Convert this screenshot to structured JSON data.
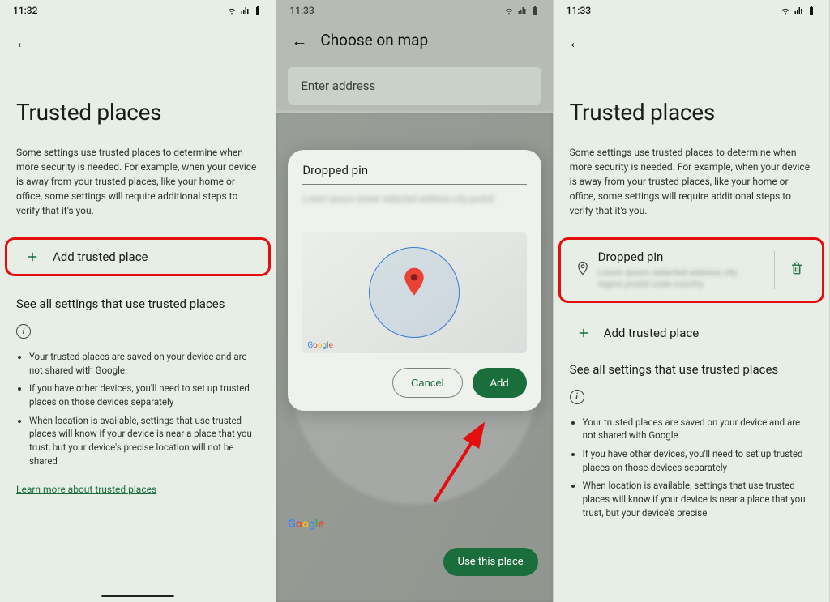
{
  "screen1": {
    "time": "11:32",
    "page_title": "Trusted places",
    "description": "Some settings use trusted places to determine when more security is needed. For example, when your device is away from your trusted places, like your home or office, some settings will require additional steps to verify that it's you.",
    "add_trusted_label": "Add trusted place",
    "section_title": "See all settings that use trusted places",
    "bullets": [
      "Your trusted places are saved on your device and are not shared with Google",
      "If you have other devices, you'll need to set up trusted places on those devices separately",
      "When location is available, settings that use trusted places will know if your device is near a place that you trust, but your device's precise location will not be shared"
    ],
    "learn_more": "Learn more about trusted places"
  },
  "screen2": {
    "time": "11:33",
    "topbar_title": "Choose on map",
    "search_placeholder": "Enter address",
    "modal_title": "Dropped pin",
    "modal_address_blur": "Lorem ipsum street redacted address city postal",
    "cancel_label": "Cancel",
    "add_label": "Add",
    "use_place_label": "Use this place",
    "google_attrib": "Google"
  },
  "screen3": {
    "time": "11:33",
    "page_title": "Trusted places",
    "description": "Some settings use trusted places to determine when more security is needed. For example, when your device is away from your trusted places, like your home or office, some settings will require additional steps to verify that it's you.",
    "dropped_pin_title": "Dropped pin",
    "dropped_address_blur": "Lorem ipsum redacted address city region postal code country",
    "add_trusted_label": "Add trusted place",
    "section_title": "See all settings that use trusted places",
    "bullets": [
      "Your trusted places are saved on your device and are not shared with Google",
      "If you have other devices, you'll need to set up trusted places on those devices separately",
      "When location is available, settings that use trusted places will know if your device is near a place that you trust, but your device's precise"
    ]
  },
  "icons": {
    "wifi": "wifi-icon",
    "signal": "signal-icon",
    "battery": "battery-icon"
  }
}
